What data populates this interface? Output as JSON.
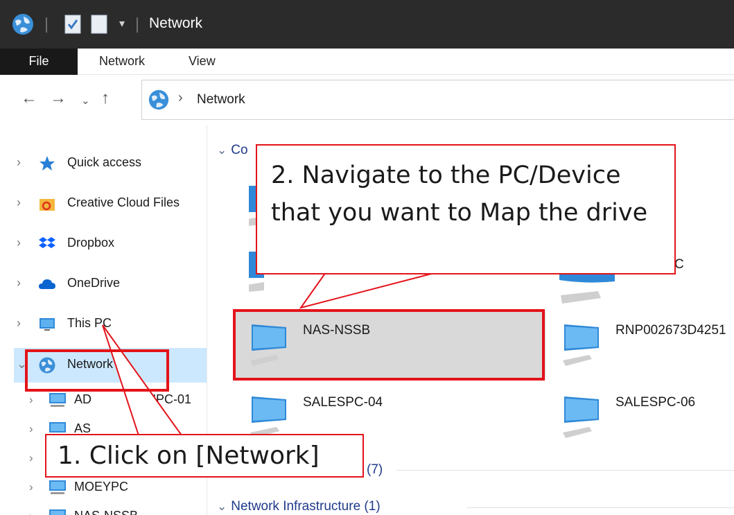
{
  "window": {
    "title": "Network"
  },
  "ribbon": {
    "tabs": [
      "File",
      "Network",
      "View"
    ]
  },
  "address": {
    "path": "Network"
  },
  "nav": {
    "items": [
      {
        "label": "Quick access",
        "icon": "star-icon"
      },
      {
        "label": "Creative Cloud Files",
        "icon": "creative-cloud-icon"
      },
      {
        "label": "Dropbox",
        "icon": "dropbox-icon"
      },
      {
        "label": "OneDrive",
        "icon": "cloud-icon"
      },
      {
        "label": "This PC",
        "icon": "monitor-icon"
      },
      {
        "label": "Network",
        "icon": "globe-icon"
      }
    ],
    "network_children": [
      "ADMINPC-01",
      "AS",
      "",
      "MOEYPC",
      "NAS-NSSB"
    ],
    "network_children_visible": [
      "AD",
      "NPC-01",
      "AS",
      "MOEYPC",
      "NAS-NSSB"
    ]
  },
  "content": {
    "group_computers_visible": "Co",
    "group_media_count": "(7)",
    "group_infrastructure": "Network Infrastructure (1)",
    "partial_right_label": "C",
    "devices": [
      {
        "name": "NAS-NSSB"
      },
      {
        "name": "RNP002673D4251"
      },
      {
        "name": "SALESPC-04"
      },
      {
        "name": "SALESPC-06"
      }
    ]
  },
  "annotations": {
    "step1": "1. Click on [Network]",
    "step2": "2. Navigate to the PC/Device that you want to Map the drive"
  },
  "colors": {
    "highlight": "#e3131a",
    "selection": "#cce8ff",
    "tile_selected": "#d9d9d9",
    "titlebar": "#2b2b2b"
  }
}
